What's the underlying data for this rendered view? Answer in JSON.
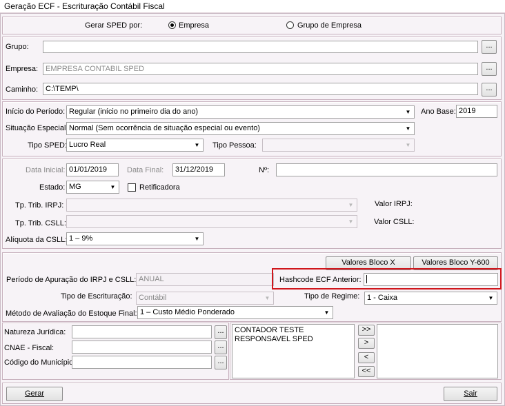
{
  "window": {
    "title": "Geração ECF - Escrituração Contábil Fiscal"
  },
  "gerar_sped": {
    "label": "Gerar SPED por:",
    "options": [
      "Empresa",
      "Grupo de Empresa"
    ],
    "selected": "Empresa"
  },
  "grupo": {
    "label": "Grupo:",
    "value": "",
    "browse": "..."
  },
  "empresa": {
    "label": "Empresa:",
    "value": "EMPRESA CONTABIL SPED",
    "browse": "..."
  },
  "caminho": {
    "label": "Caminho:",
    "value": "C:\\TEMP\\",
    "browse": "..."
  },
  "periodo": {
    "inicio_label": "Início do Período:",
    "inicio_value": "Regular (início no primeiro dia do ano)",
    "ano_base_label": "Ano Base:",
    "ano_base_value": "2019",
    "situacao_label": "Situação Especial:",
    "situacao_value": "Normal (Sem ocorrência de situação especial ou evento)",
    "tipo_sped_label": "Tipo SPED:",
    "tipo_sped_value": "Lucro Real",
    "tipo_pessoa_label": "Tipo Pessoa:",
    "tipo_pessoa_value": ""
  },
  "datas": {
    "inicial_label": "Data Inicial:",
    "inicial_value": "01/01/2019",
    "final_label": "Data Final:",
    "final_value": "31/12/2019",
    "numero_label": "Nº:",
    "numero_value": "",
    "estado_label": "Estado:",
    "estado_value": "MG",
    "retificadora_label": "Retificadora",
    "tp_irpj_label": "Tp. Trib. IRPJ:",
    "tp_irpj_value": "",
    "valor_irpj_label": "Valor IRPJ:",
    "tp_csll_label": "Tp. Trib. CSLL:",
    "tp_csll_value": "",
    "valor_csll_label": "Valor CSLL:",
    "aliquota_label": "Alíquota da CSLL:",
    "aliquota_value": "1 – 9%"
  },
  "blocos": {
    "valores_x": "Valores Bloco X",
    "valores_y600": "Valores Bloco Y-600",
    "periodo_apuracao_label": "Período de Apuração do IRPJ e CSLL:",
    "periodo_apuracao_value": "ANUAL",
    "hashcode_label": "Hashcode ECF Anterior:",
    "hashcode_value": "",
    "tipo_escrituracao_label": "Tipo de Escrituração:",
    "tipo_escrituracao_value": "Contábil",
    "tipo_regime_label": "Tipo de Regime:",
    "tipo_regime_value": "1  - Caixa",
    "metodo_label": "Método de Avaliação do Estoque Final:",
    "metodo_value": "1 – Custo Médio Ponderado"
  },
  "bottom": {
    "natureza_label": "Natureza Jurídica:",
    "cnae_label": "CNAE - Fiscal:",
    "municipio_label": "Código do Município:",
    "browse": "...",
    "list_left": [
      "CONTADOR TESTE",
      "RESPONSAVEL SPED"
    ],
    "move_all_right": ">>",
    "move_right": ">",
    "move_left": "<",
    "move_all_left": "<<"
  },
  "footer": {
    "gerar": "Gerar",
    "sair": "Sair"
  },
  "colors": {
    "highlight": "#d0161c",
    "background": "#f7f3f7"
  }
}
